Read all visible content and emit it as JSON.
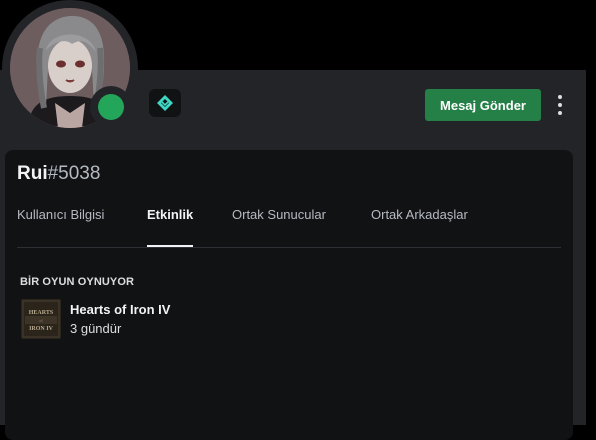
{
  "header": {
    "send_message_label": "Mesaj Gönder",
    "status": "online",
    "badge_icon": "hypesquad-icon"
  },
  "profile": {
    "username": "Rui",
    "discriminator": "#5038"
  },
  "tabs": [
    {
      "label": "Kullanıcı Bilgisi",
      "active": false
    },
    {
      "label": "Etkinlik",
      "active": true
    },
    {
      "label": "Ortak Sunucular",
      "active": false
    },
    {
      "label": "Ortak Arkadaşlar",
      "active": false
    }
  ],
  "activity": {
    "section_title": "BİR OYUN OYNUYOR",
    "game_name": "Hearts of Iron IV",
    "elapsed": "3 gündür",
    "icon_text": "HEARTS of IRON IV"
  },
  "colors": {
    "accent_green": "#248046",
    "status_online": "#23a55a",
    "panel_bg": "#232428",
    "card_bg": "#111214",
    "badge_teal": "#3ed6c4"
  }
}
